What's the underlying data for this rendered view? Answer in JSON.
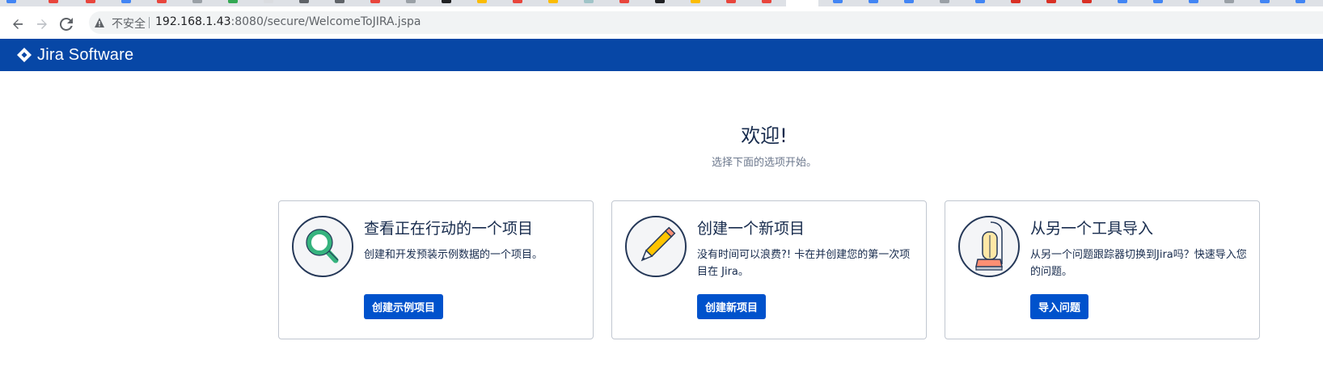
{
  "browser": {
    "insecure_label": "不安全",
    "url_host": "192.168.1.43",
    "url_rest": ":8080/secure/WelcomeToJIRA.jspa"
  },
  "header": {
    "brand": "Jira Software"
  },
  "welcome": {
    "title": "欢迎!",
    "subtitle": "选择下面的选项开始。"
  },
  "cards": [
    {
      "title": "查看正在行动的一个项目",
      "description": "创建和开发预装示例数据的一个项目。",
      "button": "创建示例项目",
      "icon": "magnifier-icon"
    },
    {
      "title": "创建一个新项目",
      "description": "没有时间可以浪费?! 卡在并创建您的第一次项目在 Jira。",
      "button": "创建新项目",
      "icon": "pencil-icon"
    },
    {
      "title": "从另一个工具导入",
      "description": "从另一个问题跟踪器切换到Jira吗？快速导入您的问题。",
      "button": "导入问题",
      "icon": "vacuum-icon"
    }
  ],
  "colors": {
    "header_bg": "#0747a6",
    "button_bg": "#0052cc",
    "text": "#172b4d",
    "muted_text": "#6b778c"
  }
}
